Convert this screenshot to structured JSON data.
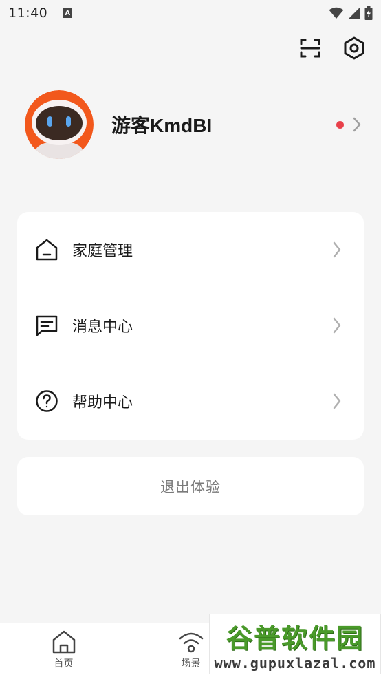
{
  "status_bar": {
    "time": "11:40",
    "notification_icon_letter": "A",
    "icons": [
      "a-notification-icon",
      "wifi-icon",
      "signal-icon",
      "battery-charging-icon"
    ]
  },
  "top_actions": {
    "icons": [
      "scan-icon",
      "settings-hexagon-icon"
    ]
  },
  "profile": {
    "username": "游客KmdBI",
    "avatar_icon": "robot-avatar",
    "has_unread_dot": true,
    "dot_color": "#e8404a"
  },
  "menu": {
    "items": [
      {
        "label": "家庭管理",
        "icon": "home-icon"
      },
      {
        "label": "消息中心",
        "icon": "message-icon"
      },
      {
        "label": "帮助中心",
        "icon": "help-icon"
      }
    ]
  },
  "logout": {
    "label": "退出体验"
  },
  "bottom_nav": {
    "items": [
      {
        "label": "首页",
        "icon": "home-nav-icon"
      },
      {
        "label": "场景",
        "icon": "scene-wifi-icon"
      }
    ]
  },
  "watermark": {
    "title": "谷普软件园",
    "url": "www.gupuxlazal.com"
  },
  "colors": {
    "background": "#f5f5f5",
    "card": "#ffffff",
    "accent_orange": "#f2581c",
    "dot_red": "#e8404a",
    "watermark_green": "#4a9a2a"
  }
}
